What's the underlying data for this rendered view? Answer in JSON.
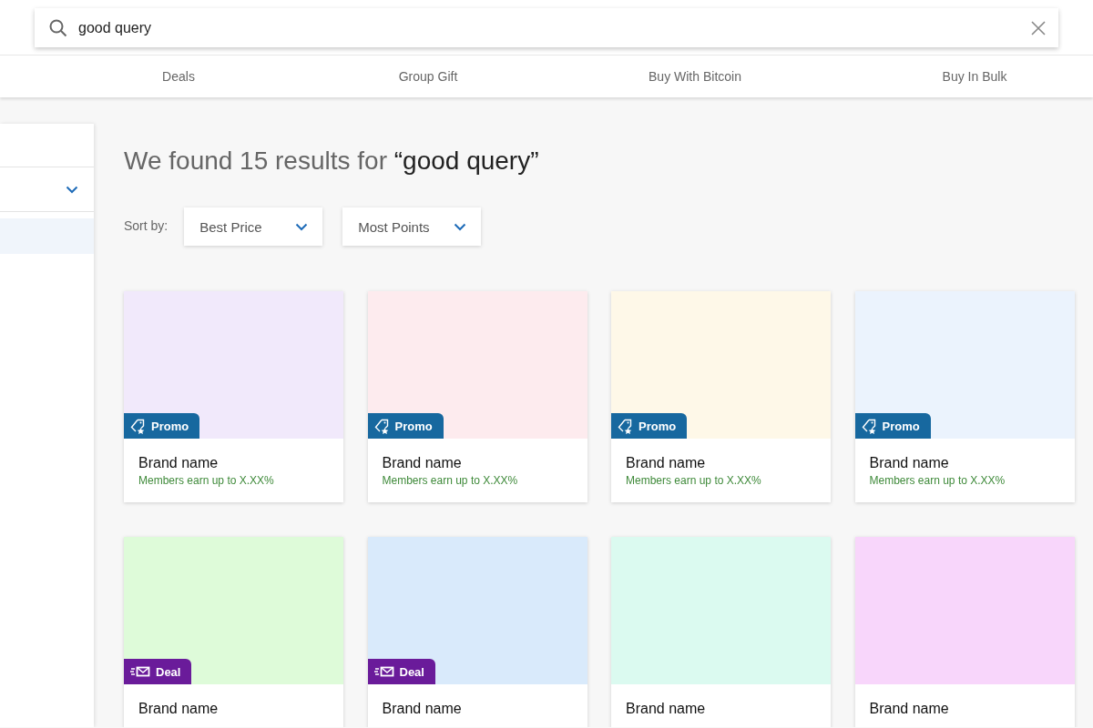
{
  "search": {
    "value": "good query"
  },
  "nav": {
    "items": [
      {
        "label": "Deals"
      },
      {
        "label": "Group Gift"
      },
      {
        "label": "Buy With Bitcoin"
      },
      {
        "label": "Buy In Bulk"
      }
    ]
  },
  "sidebar": {
    "rows": [
      {
        "kind": "header"
      },
      {
        "kind": "dropdown",
        "expanded": false
      },
      {
        "kind": "option",
        "selected": true
      }
    ]
  },
  "results": {
    "heading": "We found 15 results for ",
    "query": "“good query”"
  },
  "sort": {
    "label": "Sort by:",
    "dropdowns": [
      {
        "value": "Best Price"
      },
      {
        "value": "Most Points"
      }
    ]
  },
  "cards": [
    {
      "color": "#f1e9fb",
      "badge": {
        "kind": "promo",
        "label": "Promo"
      },
      "brand": "Brand name",
      "subtitle": "Members earn up to X.XX%"
    },
    {
      "color": "#fdebee",
      "badge": {
        "kind": "promo",
        "label": "Promo"
      },
      "brand": "Brand name",
      "subtitle": "Members earn up to X.XX%"
    },
    {
      "color": "#fef8e8",
      "badge": {
        "kind": "promo",
        "label": "Promo"
      },
      "brand": "Brand name",
      "subtitle": "Members earn up to X.XX%"
    },
    {
      "color": "#ebf3fd",
      "badge": {
        "kind": "promo",
        "label": "Promo"
      },
      "brand": "Brand name",
      "subtitle": "Members earn up to X.XX%"
    },
    {
      "color": "#defbd9",
      "badge": {
        "kind": "deal",
        "label": "Deal"
      },
      "brand": "Brand name"
    },
    {
      "color": "#d9eafb",
      "badge": {
        "kind": "deal",
        "label": "Deal"
      },
      "brand": "Brand name"
    },
    {
      "color": "#dbfaf0",
      "brand": "Brand name"
    },
    {
      "color": "#f8d6fb",
      "brand": "Brand name"
    }
  ]
}
